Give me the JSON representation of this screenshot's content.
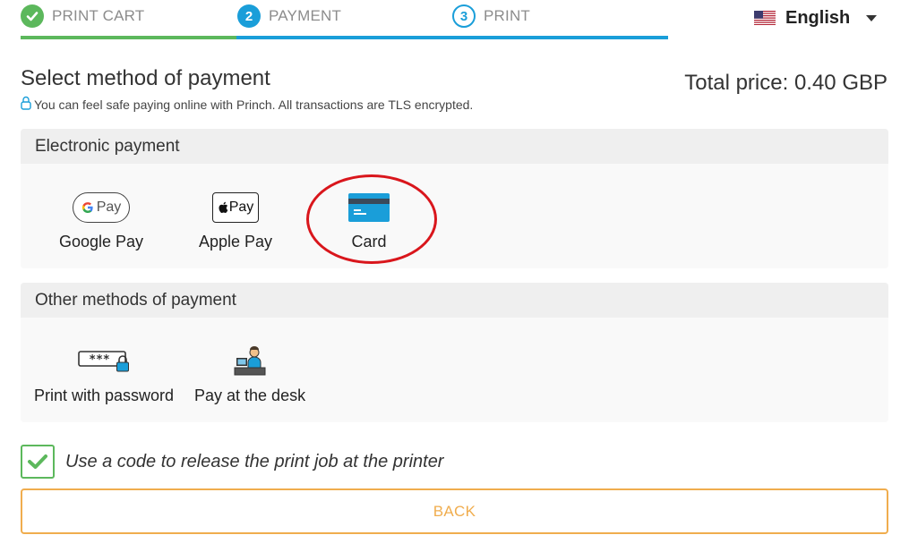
{
  "stepper": {
    "steps": [
      {
        "number": "✔",
        "label": "PRINT CART",
        "state": "completed"
      },
      {
        "number": "2",
        "label": "PAYMENT",
        "state": "active"
      },
      {
        "number": "3",
        "label": "PRINT",
        "state": "upcoming"
      }
    ],
    "colors": {
      "completed": "#5cb85c",
      "active": "#1a9ed9"
    }
  },
  "language": {
    "label": "English",
    "flag_icon": "us-flag-icon"
  },
  "header": {
    "title": "Select method of payment",
    "safe_note": "You can feel safe paying online with Princh. All transactions are TLS encrypted.",
    "total_price": "Total price: 0.40 GBP"
  },
  "electronic": {
    "heading": "Electronic payment",
    "options": [
      {
        "label": "Google Pay",
        "icon": "google-pay-icon",
        "badge": "Pay"
      },
      {
        "label": "Apple Pay",
        "icon": "apple-pay-icon",
        "badge": "Pay"
      },
      {
        "label": "Card",
        "icon": "card-icon",
        "highlighted": true
      }
    ]
  },
  "other": {
    "heading": "Other methods of payment",
    "options": [
      {
        "label": "Print with password",
        "icon": "password-lock-icon",
        "badge": "***"
      },
      {
        "label": "Pay at the desk",
        "icon": "desk-clerk-icon"
      }
    ]
  },
  "release_code": {
    "label": "Use a code to release the print job at the printer",
    "checked": true
  },
  "back_button": {
    "label": "BACK",
    "color": "#f0ad4e"
  }
}
